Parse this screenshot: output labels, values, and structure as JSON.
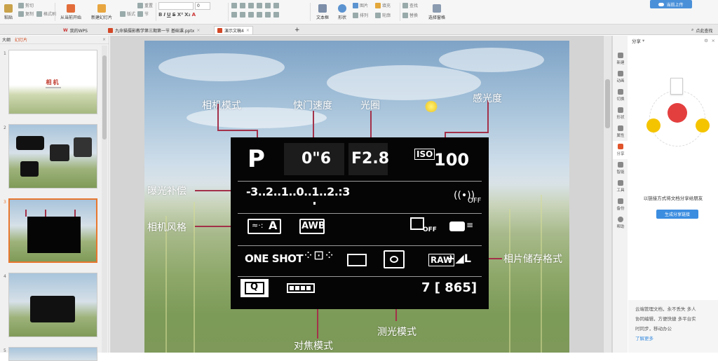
{
  "ribbon": {
    "paste": "粘贴",
    "cut": "剪切",
    "copy": "复制",
    "format_painter": "格式刷",
    "from_current": "从当前开始",
    "new_slide": "新建幻灯片",
    "layout": "版式",
    "section": "节",
    "reset": "重置",
    "font_size": "0",
    "textbox": "文本框",
    "shape": "形状",
    "picture": "图片",
    "fill": "填充",
    "arrange": "排列",
    "outline": "轮廓",
    "find": "查找",
    "replace": "替换",
    "select_pane": "选择窗格",
    "upload_btn": "当前上传"
  },
  "tabs": [
    {
      "label": "我的WPS"
    },
    {
      "label": "九命猫摄影教学第三期第一节 基础课.pptx"
    },
    {
      "label": "演示文稿4"
    }
  ],
  "tab_plus": "+",
  "search_label": "点此查找",
  "left_panel": {
    "tab_outline": "大纲",
    "tab_slides": "幻灯片",
    "slide_numbers": [
      "1",
      "2",
      "3",
      "4",
      "5"
    ],
    "slide1_title": "相机"
  },
  "slide": {
    "labels": {
      "mode": "相机模式",
      "shutter": "快门速度",
      "aperture": "光圈",
      "iso": "感光度",
      "exposure": "曝光补偿",
      "style": "相机风格",
      "storage": "相片储存格式",
      "focus": "对焦模式",
      "metering": "测光模式"
    },
    "panel": {
      "mode_letter": "P",
      "shutter_value": "0\"6",
      "aperture_value": "F2.8",
      "iso_tag": "ISO",
      "iso_value": "100",
      "exposure_scale": "-3..2..1..0..1..2.:3",
      "wifi_off": "OFF",
      "style_tag": "A",
      "awb": "AWB",
      "style_off": "OFF",
      "one_shot": "ONE SHOT",
      "raw": "RAW",
      "large": "+◢L",
      "q": "Q",
      "shots": "7 [ 865]"
    }
  },
  "right_sidebar": {
    "items": [
      "新建",
      "动画",
      "切换",
      "形状",
      "属性",
      "分享",
      "智能",
      "工具",
      "备份",
      "帮助"
    ]
  },
  "share_panel": {
    "title": "分享",
    "description": "以链接方式将文档分享给朋友",
    "button": "生成分享链接",
    "cloud_line1": "云端管理文档，永不丢失 多人",
    "cloud_line2": "协同编辑，方便快捷 多平台实",
    "cloud_line3": "时同步，移动办公",
    "more_link": "了解更多"
  },
  "colors": {
    "accent": "#d04a1e",
    "share_blue": "#3b8de0",
    "callout_line": "#a3314a",
    "panel_bg": "#050505"
  }
}
